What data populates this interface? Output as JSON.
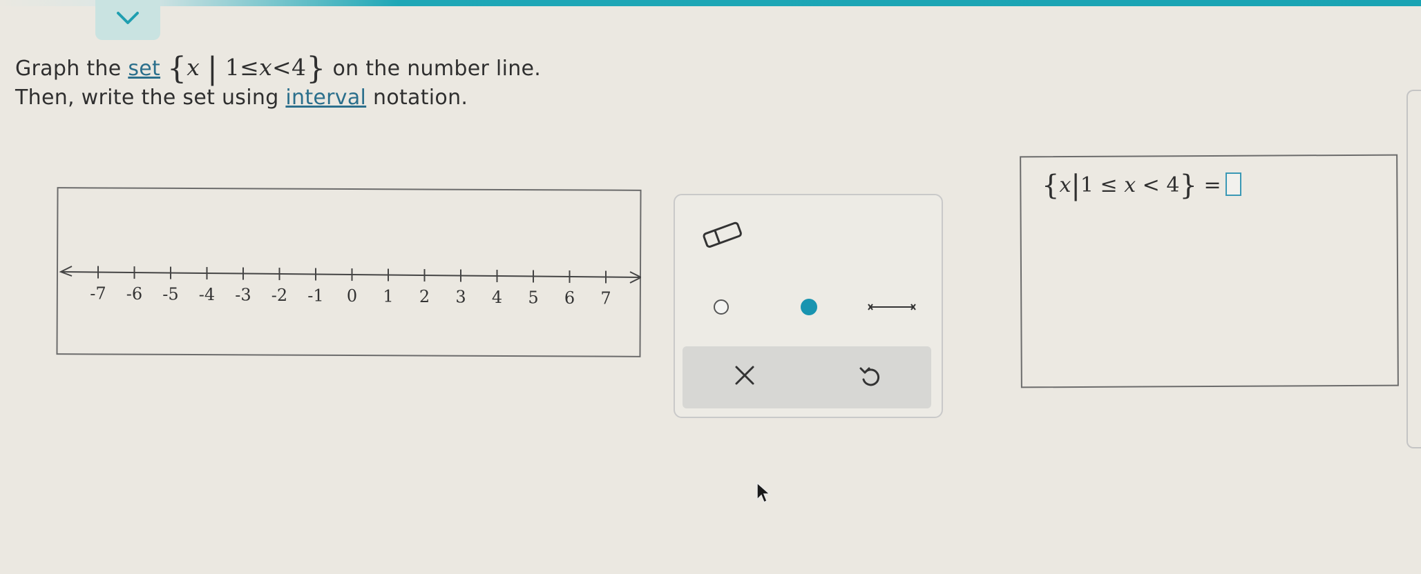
{
  "colors": {
    "accent": "#1fa7b6",
    "link": "#2b6f8c",
    "closed_point": "#1994b0"
  },
  "header": {
    "collapse_icon": "chevron-down-icon"
  },
  "question": {
    "line1_pre": "Graph the",
    "link_set": "set",
    "math": {
      "open_brace": "{",
      "var": "x",
      "bar": "|",
      "lower": "1",
      "leq": "≤",
      "var2": "x",
      "lt": "<",
      "upper": "4",
      "close_brace": "}"
    },
    "line1_post": "on the number line.",
    "line2_pre": "Then, write the set using",
    "link_interval": "interval",
    "line2_post": "notation."
  },
  "number_line": {
    "ticks": [
      "-7",
      "-6",
      "-5",
      "-4",
      "-3",
      "-2",
      "-1",
      "0",
      "1",
      "2",
      "3",
      "4",
      "5",
      "6",
      "7"
    ]
  },
  "tools": {
    "items": [
      {
        "name": "eraser-tool",
        "icon": "eraser-icon"
      },
      {
        "name": "open-point-tool",
        "icon": "open-circle-icon"
      },
      {
        "name": "closed-point-tool",
        "icon": "filled-circle-icon"
      },
      {
        "name": "segment-tool",
        "icon": "segment-icon"
      }
    ],
    "clear_icon": "close-icon",
    "undo_icon": "undo-icon"
  },
  "answer": {
    "open_brace": "{",
    "var": "x",
    "bar": "|",
    "lower": "1",
    "leq": "≤",
    "var2": "x",
    "lt": "<",
    "upper": "4",
    "close_brace": "}",
    "equals": "=",
    "input_value": ""
  }
}
